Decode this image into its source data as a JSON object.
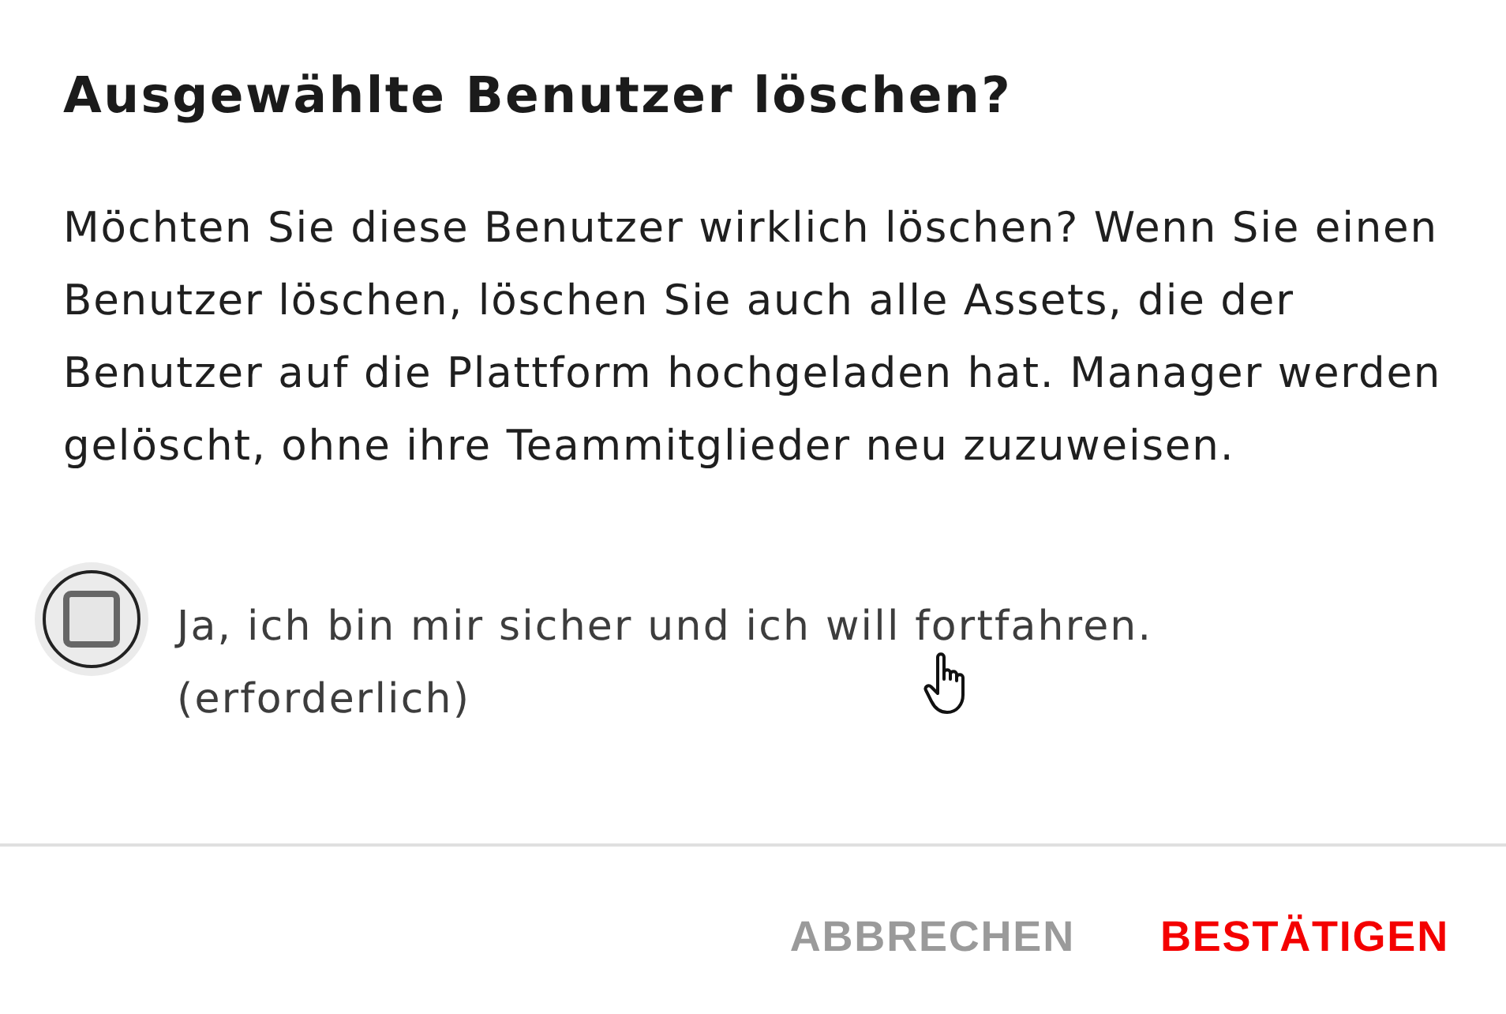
{
  "dialog": {
    "title": "Ausgewählte Benutzer löschen?",
    "message": "Möchten Sie diese Benutzer wirklich löschen? Wenn Sie einen Benutzer löschen, löschen Sie auch alle Assets, die der Benutzer auf die Plattform hochgeladen hat. Manager werden gelöscht, ohne ihre Teammitglieder neu zuzuweisen.",
    "confirmation": {
      "label": "Ja, ich bin mir sicher und ich will fortfahren.",
      "note": "(erforderlich)",
      "checked": false
    },
    "buttons": [
      {
        "label": "ABBRECHEN",
        "kind": "cancel"
      },
      {
        "label": "BESTÄTIGEN",
        "kind": "confirm"
      }
    ]
  }
}
